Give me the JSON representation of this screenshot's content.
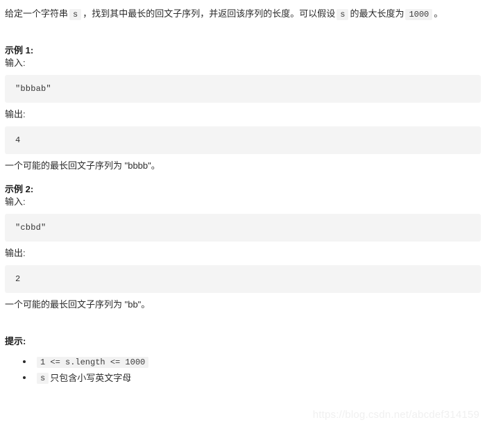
{
  "problem": {
    "intro": {
      "part1": "给定一个字符串",
      "code1": "s",
      "part2": "，找到其中最长的回文子序列，并返回该序列的长度。可以假设",
      "code2": "s",
      "part3": "的最大长度为",
      "code3": "1000",
      "part4": "。"
    },
    "examples": [
      {
        "heading": "示例 1:",
        "input_label": "输入:",
        "input_code": "\"bbbab\"",
        "output_label": "输出:",
        "output_code": "4",
        "explanation": "一个可能的最长回文子序列为 \"bbbb\"。"
      },
      {
        "heading": "示例 2:",
        "input_label": "输入:",
        "input_code": "\"cbbd\"",
        "output_label": "输出:",
        "output_code": "2",
        "explanation": "一个可能的最长回文子序列为 \"bb\"。"
      }
    ],
    "hints": {
      "heading": "提示:",
      "items": [
        {
          "code": "1 <= s.length <= 1000",
          "text": ""
        },
        {
          "code": "s",
          "text": "只包含小写英文字母"
        }
      ]
    }
  },
  "watermark": {
    "text": "https://blog.csdn.net/abcdef314159"
  },
  "colors": {
    "page_background": "#ffffff",
    "body_text": "#2b2b2b",
    "code_block_background": "#f4f4f4",
    "inline_code_background": "#f2f2f2",
    "code_text": "#333333",
    "watermark_text": "#f0f0f0"
  }
}
